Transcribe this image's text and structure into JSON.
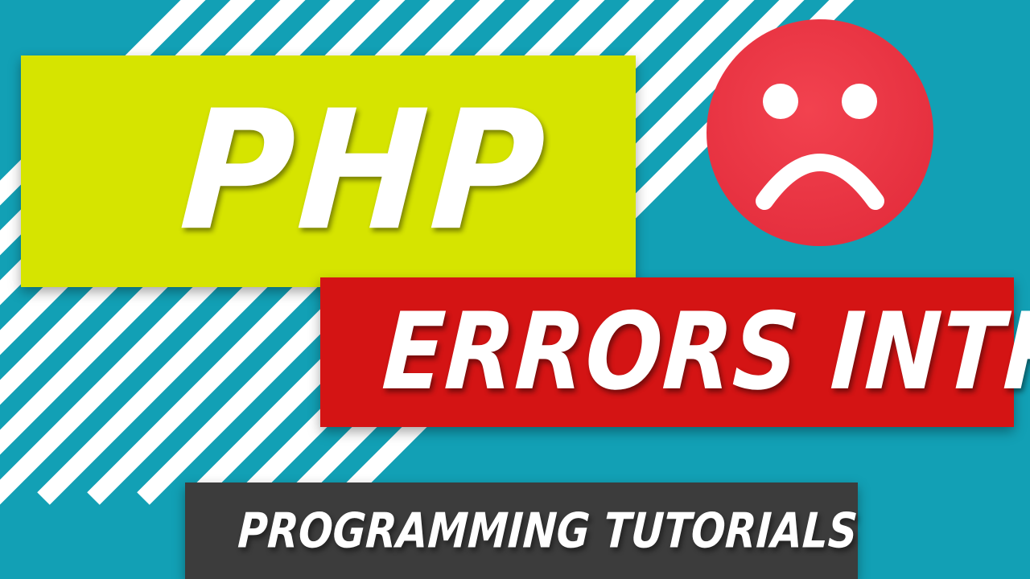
{
  "title": {
    "primary": "PHP",
    "secondary": "Errors Intro",
    "series": "Programming Tutorials"
  },
  "icons": {
    "sad_face": "sad-face-icon"
  },
  "colors": {
    "background": "#12a0b5",
    "stripes": "#ffffff",
    "php_banner": "#d6e400",
    "errors_banner": "#d41414",
    "tutorials_banner": "#3c3c3c",
    "sad_face": "#ef3a48",
    "text": "#ffffff"
  }
}
